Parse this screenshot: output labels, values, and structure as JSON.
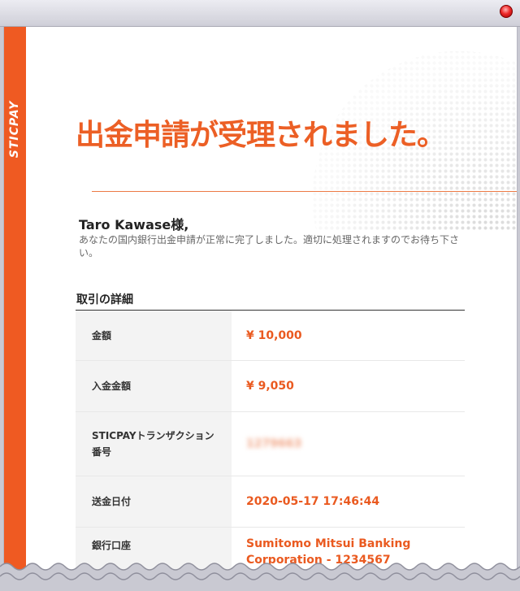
{
  "brand": {
    "name": "STICPAY"
  },
  "hero": {
    "title": "出金申請が受理されました。"
  },
  "greeting": "Taro Kawase様,",
  "message": "あなたの国内銀行出金申請が正常に完了しました。適切に処理されますのでお待ち下さい。",
  "details": {
    "title": "取引の詳細",
    "rows": [
      {
        "label": "金額",
        "value": "¥ 10,000"
      },
      {
        "label": "入金金額",
        "value": "¥ 9,050"
      },
      {
        "label": "STICPAYトランザクション番号",
        "value": "1279663"
      },
      {
        "label": "送金日付",
        "value": "2020-05-17 17:46:44"
      },
      {
        "label": "銀行口座",
        "value": "Sumitomo Mitsui Banking Corporation - 1234567"
      }
    ]
  },
  "colors": {
    "accent": "#ec5f25",
    "sidebar": "#ef5a22"
  },
  "icons": {
    "close": "close-icon",
    "globe": "globe-icon"
  }
}
